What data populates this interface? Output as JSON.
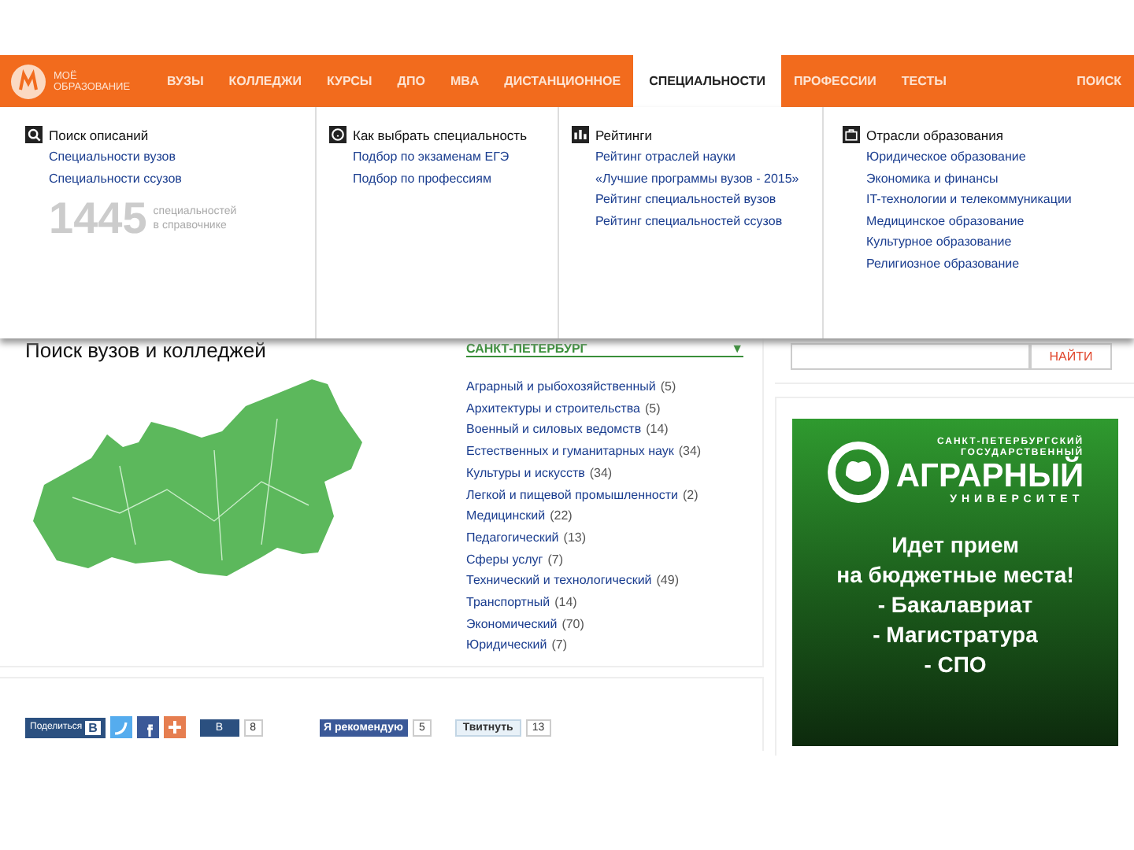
{
  "logo": {
    "line1": "МОЁ",
    "line2": "ОБРАЗОВАНИЕ"
  },
  "nav": [
    {
      "label": "ВУЗЫ",
      "selected": false
    },
    {
      "label": "КОЛЛЕДЖИ",
      "selected": false
    },
    {
      "label": "КУРСЫ",
      "selected": false
    },
    {
      "label": "ДПО",
      "selected": false
    },
    {
      "label": "MBA",
      "selected": false
    },
    {
      "label": "ДИСТАНЦИОННОЕ",
      "selected": false
    },
    {
      "label": "СПЕЦИАЛЬНОСТИ",
      "selected": true
    },
    {
      "label": "ПРОФЕССИИ",
      "selected": false
    },
    {
      "label": "ТЕСТЫ",
      "selected": false
    },
    {
      "label": "ПОИСК",
      "selected": false
    }
  ],
  "dropdown": [
    {
      "title": "Поиск описаний",
      "links": [
        "Специальности вузов",
        "Специальности ссузов"
      ],
      "stat": {
        "number": "1445",
        "caption": "специальностей в справочнике"
      }
    },
    {
      "title": "Как выбрать специальность",
      "links": [
        "Подбор по экзаменам ЕГЭ",
        "Подбор по профессиям"
      ]
    },
    {
      "title": "Рейтинги",
      "links": [
        "Рейтинг отраслей науки",
        "«Лучшие программы вузов - 2015»",
        "Рейтинг специальностей вузов",
        "Рейтинг специальностей ссузов"
      ]
    },
    {
      "title": "Отрасли образования",
      "links": [
        "Юридическое образование",
        "Экономика и финансы",
        "IT-технологии и телекоммуникации",
        "Медицинское образование",
        "Культурное образование",
        "Религиозное образование"
      ]
    }
  ],
  "search_panel": {
    "title": "Поиск вузов и колледжей",
    "region": "САНКТ-ПЕТЕРБУРГ",
    "region_arrow": "▼",
    "categories": [
      {
        "name": "Аграрный и рыбохозяйственный",
        "count": "(5)"
      },
      {
        "name": "Архитектуры и строительства",
        "count": "(5)"
      },
      {
        "name": "Военный и силовых ведомств",
        "count": "(14)"
      },
      {
        "name": "Естественных и гуманитарных наук",
        "count": "(34)"
      },
      {
        "name": "Культуры и искусств",
        "count": "(34)"
      },
      {
        "name": "Легкой и пищевой промышленности",
        "count": "(2)"
      },
      {
        "name": "Медицинский",
        "count": "(22)"
      },
      {
        "name": "Педагогический",
        "count": "(13)"
      },
      {
        "name": "Сферы услуг",
        "count": "(7)"
      },
      {
        "name": "Технический и технологический",
        "count": "(49)"
      },
      {
        "name": "Транспортный",
        "count": "(14)"
      },
      {
        "name": "Экономический",
        "count": "(70)"
      },
      {
        "name": "Юридический",
        "count": "(7)"
      }
    ]
  },
  "share": {
    "share_label": "Поделиться",
    "vk_letter": "В",
    "vk_button": "В",
    "vk_count": "8",
    "fb_button": "Я рекомендую",
    "fb_count": "5",
    "tw_button": "Твитнуть",
    "tw_count": "13"
  },
  "site_search": {
    "button": "НАЙТИ"
  },
  "banner": {
    "line1": "САНКТ-ПЕТЕРБУРГСКИЙ",
    "line2": "ГОСУДАРСТВЕННЫЙ",
    "name": "АГРАРНЫЙ",
    "subtitle": "УНИВЕРСИТЕТ",
    "headline": [
      "Идет прием",
      "на бюджетные места!"
    ],
    "items": [
      "- Бакалавриат",
      "- Магистратура",
      "- СПО"
    ]
  }
}
